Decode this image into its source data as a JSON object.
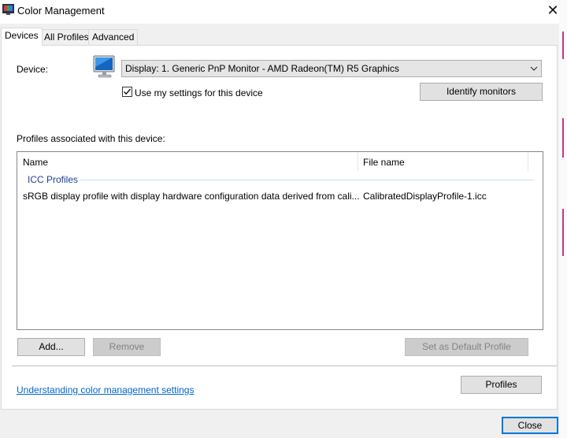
{
  "window": {
    "title": "Color Management"
  },
  "tabs": [
    {
      "label": "Devices",
      "active": true
    },
    {
      "label": "All Profiles",
      "active": false
    },
    {
      "label": "Advanced",
      "active": false
    }
  ],
  "device": {
    "label": "Device:",
    "selected": "Display: 1. Generic PnP Monitor - AMD Radeon(TM) R5 Graphics",
    "use_my_settings": {
      "label": "Use my settings for this device",
      "checked": true
    },
    "identify_button": "Identify monitors"
  },
  "profiles": {
    "section_label": "Profiles associated with this device:",
    "columns": [
      "Name",
      "File name"
    ],
    "group": "ICC Profiles",
    "rows": [
      {
        "name": "sRGB display profile with display hardware configuration data derived from cali...",
        "file": "CalibratedDisplayProfile-1.icc"
      }
    ]
  },
  "buttons": {
    "add": "Add...",
    "remove": "Remove",
    "set_default": "Set as Default Profile",
    "profiles": "Profiles",
    "close": "Close"
  },
  "link": "Understanding color management settings",
  "colors": {
    "link": "#0066cc",
    "accent": "#0078d7",
    "group_header": "#1e3e9e"
  }
}
